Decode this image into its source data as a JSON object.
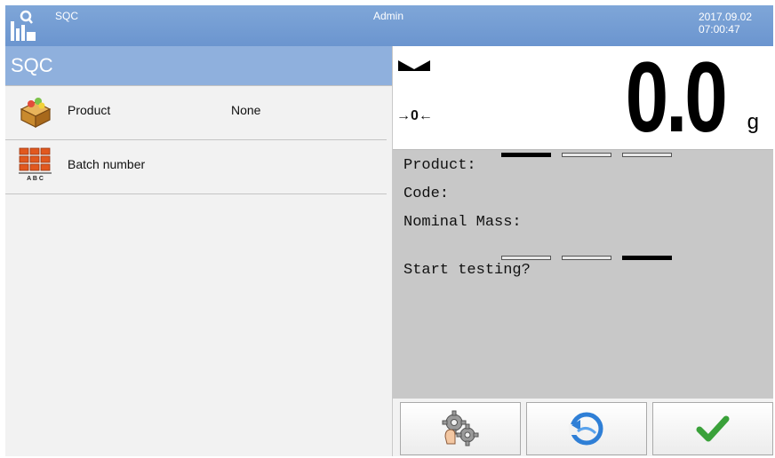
{
  "header": {
    "app_name": "SQC",
    "user": "Admin",
    "date": "2017.09.02",
    "time": "07:00:47"
  },
  "left_panel": {
    "title": "SQC",
    "items": [
      {
        "label": "Product",
        "value": "None",
        "icon": "product-box-icon"
      },
      {
        "label": "Batch number",
        "value": "",
        "icon": "batch-abc-icon"
      }
    ]
  },
  "weight": {
    "value": "0.0",
    "unit": "g",
    "zero_indicator": "→0←",
    "stable_icon": "stability-marker-icon"
  },
  "info": {
    "product_label": "Product:",
    "code_label": "Code:",
    "nominal_mass_label": "Nominal Mass:",
    "prompt": "Start testing?"
  },
  "buttons": [
    {
      "icon": "settings-gears-icon"
    },
    {
      "icon": "back-return-icon"
    },
    {
      "icon": "confirm-check-icon"
    }
  ],
  "colors": {
    "topbar": "#7fa6d8",
    "panel_header": "#8fb0dd",
    "info_bg": "#c8c8c8",
    "check": "#3aa13a"
  }
}
